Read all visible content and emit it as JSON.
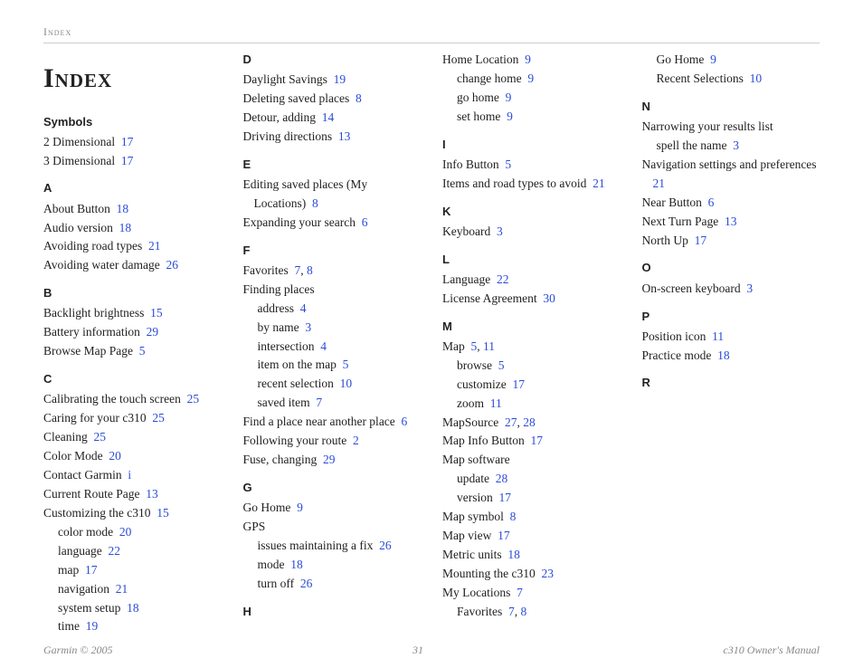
{
  "header": {
    "running": "Index",
    "title": "Index"
  },
  "footer": {
    "left": "Garmin © 2005",
    "center": "31",
    "right": "c310 Owner's Manual"
  },
  "sections": [
    {
      "letter": "Symbols",
      "entries": [
        {
          "text": "2 Dimensional",
          "pages": [
            "17"
          ]
        },
        {
          "text": "3 Dimensional",
          "pages": [
            "17"
          ]
        }
      ]
    },
    {
      "letter": "A",
      "entries": [
        {
          "text": "About Button",
          "pages": [
            "18"
          ]
        },
        {
          "text": "Audio version",
          "pages": [
            "18"
          ]
        },
        {
          "text": "Avoiding road types",
          "pages": [
            "21"
          ]
        },
        {
          "text": "Avoiding water damage",
          "pages": [
            "26"
          ]
        }
      ]
    },
    {
      "letter": "B",
      "entries": [
        {
          "text": "Backlight brightness",
          "pages": [
            "15"
          ]
        },
        {
          "text": "Battery information",
          "pages": [
            "29"
          ]
        },
        {
          "text": "Browse Map Page",
          "pages": [
            "5"
          ]
        }
      ]
    },
    {
      "letter": "C",
      "entries": [
        {
          "text": "Calibrating the touch screen",
          "pages": [
            "25"
          ]
        },
        {
          "text": "Caring for your c310",
          "pages": [
            "25"
          ]
        },
        {
          "text": "Cleaning",
          "pages": [
            "25"
          ]
        },
        {
          "text": "Color Mode",
          "pages": [
            "20"
          ]
        },
        {
          "text": "Contact Garmin",
          "pages": [
            "i"
          ]
        },
        {
          "text": "Current Route Page",
          "pages": [
            "13"
          ]
        },
        {
          "text": "Customizing the c310",
          "pages": [
            "15"
          ]
        },
        {
          "text": "color mode",
          "pages": [
            "20"
          ],
          "sub": true
        },
        {
          "text": "language",
          "pages": [
            "22"
          ],
          "sub": true
        },
        {
          "text": "map",
          "pages": [
            "17"
          ],
          "sub": true
        },
        {
          "text": "navigation",
          "pages": [
            "21"
          ],
          "sub": true
        },
        {
          "text": "system setup",
          "pages": [
            "18"
          ],
          "sub": true
        },
        {
          "text": "time",
          "pages": [
            "19"
          ],
          "sub": true
        }
      ]
    },
    {
      "letter": "D",
      "entries": [
        {
          "text": "Daylight Savings",
          "pages": [
            "19"
          ]
        },
        {
          "text": "Deleting saved places",
          "pages": [
            "8"
          ]
        },
        {
          "text": "Detour, adding",
          "pages": [
            "14"
          ]
        },
        {
          "text": "Driving directions",
          "pages": [
            "13"
          ]
        }
      ]
    },
    {
      "letter": "E",
      "entries": [
        {
          "text": "Editing saved places (My Locations)",
          "pages": [
            "8"
          ]
        },
        {
          "text": "Expanding your search",
          "pages": [
            "6"
          ]
        }
      ]
    },
    {
      "letter": "F",
      "entries": [
        {
          "text": "Favorites",
          "pages": [
            "7",
            "8"
          ]
        },
        {
          "text": "Finding places"
        },
        {
          "text": "address",
          "pages": [
            "4"
          ],
          "sub": true
        },
        {
          "text": "by name",
          "pages": [
            "3"
          ],
          "sub": true
        },
        {
          "text": "intersection",
          "pages": [
            "4"
          ],
          "sub": true
        },
        {
          "text": "item on the map",
          "pages": [
            "5"
          ],
          "sub": true
        },
        {
          "text": "recent selection",
          "pages": [
            "10"
          ],
          "sub": true
        },
        {
          "text": "saved item",
          "pages": [
            "7"
          ],
          "sub": true
        },
        {
          "text": "Find a place near another place",
          "pages": [
            "6"
          ]
        },
        {
          "text": "Following your route",
          "pages": [
            "2"
          ]
        },
        {
          "text": "Fuse, changing",
          "pages": [
            "29"
          ]
        }
      ]
    },
    {
      "letter": "G",
      "entries": [
        {
          "text": "Go Home",
          "pages": [
            "9"
          ]
        },
        {
          "text": "GPS"
        },
        {
          "text": "issues maintaining a fix",
          "pages": [
            "26"
          ],
          "sub": true
        },
        {
          "text": "mode",
          "pages": [
            "18"
          ],
          "sub": true
        },
        {
          "text": "turn off",
          "pages": [
            "26"
          ],
          "sub": true
        }
      ]
    },
    {
      "letter": "H",
      "entries": [
        {
          "text": "Home Location",
          "pages": [
            "9"
          ]
        },
        {
          "text": "change home",
          "pages": [
            "9"
          ],
          "sub": true
        },
        {
          "text": "go home",
          "pages": [
            "9"
          ],
          "sub": true
        },
        {
          "text": "set home",
          "pages": [
            "9"
          ],
          "sub": true
        }
      ]
    },
    {
      "letter": "I",
      "entries": [
        {
          "text": "Info Button",
          "pages": [
            "5"
          ]
        },
        {
          "text": "Items and road types to avoid",
          "pages": [
            "21"
          ]
        }
      ]
    },
    {
      "letter": "K",
      "entries": [
        {
          "text": "Keyboard",
          "pages": [
            "3"
          ]
        }
      ]
    },
    {
      "letter": "L",
      "entries": [
        {
          "text": "Language",
          "pages": [
            "22"
          ]
        },
        {
          "text": "License Agreement",
          "pages": [
            "30"
          ]
        }
      ]
    },
    {
      "letter": "M",
      "entries": [
        {
          "text": "Map",
          "pages": [
            "5",
            "11"
          ]
        },
        {
          "text": "browse",
          "pages": [
            "5"
          ],
          "sub": true
        },
        {
          "text": "customize",
          "pages": [
            "17"
          ],
          "sub": true
        },
        {
          "text": "zoom",
          "pages": [
            "11"
          ],
          "sub": true
        },
        {
          "text": "MapSource",
          "pages": [
            "27",
            "28"
          ]
        },
        {
          "text": "Map Info Button",
          "pages": [
            "17"
          ]
        },
        {
          "text": "Map software"
        },
        {
          "text": "update",
          "pages": [
            "28"
          ],
          "sub": true
        },
        {
          "text": "version",
          "pages": [
            "17"
          ],
          "sub": true
        },
        {
          "text": "Map symbol",
          "pages": [
            "8"
          ]
        },
        {
          "text": "Map view",
          "pages": [
            "17"
          ]
        },
        {
          "text": "Metric units",
          "pages": [
            "18"
          ]
        },
        {
          "text": "Mounting the c310",
          "pages": [
            "23"
          ]
        },
        {
          "text": "My Locations",
          "pages": [
            "7"
          ]
        },
        {
          "text": "Favorites",
          "pages": [
            "7",
            "8"
          ],
          "sub": true
        },
        {
          "text": "Go Home",
          "pages": [
            "9"
          ],
          "sub": true
        },
        {
          "text": "Recent Selections",
          "pages": [
            "10"
          ],
          "sub": true
        }
      ]
    },
    {
      "letter": "N",
      "entries": [
        {
          "text": "Narrowing your results list"
        },
        {
          "text": "spell the name",
          "pages": [
            "3"
          ],
          "sub": true
        },
        {
          "text": "Navigation settings and preferences",
          "pages": [
            "21"
          ]
        },
        {
          "text": "Near Button",
          "pages": [
            "6"
          ]
        },
        {
          "text": "Next Turn Page",
          "pages": [
            "13"
          ]
        },
        {
          "text": "North Up",
          "pages": [
            "17"
          ]
        }
      ]
    },
    {
      "letter": "O",
      "entries": [
        {
          "text": "On-screen keyboard",
          "pages": [
            "3"
          ]
        }
      ]
    },
    {
      "letter": "P",
      "entries": [
        {
          "text": "Position icon",
          "pages": [
            "11"
          ]
        },
        {
          "text": "Practice mode",
          "pages": [
            "18"
          ]
        }
      ]
    },
    {
      "letter": "R",
      "entries": []
    }
  ]
}
